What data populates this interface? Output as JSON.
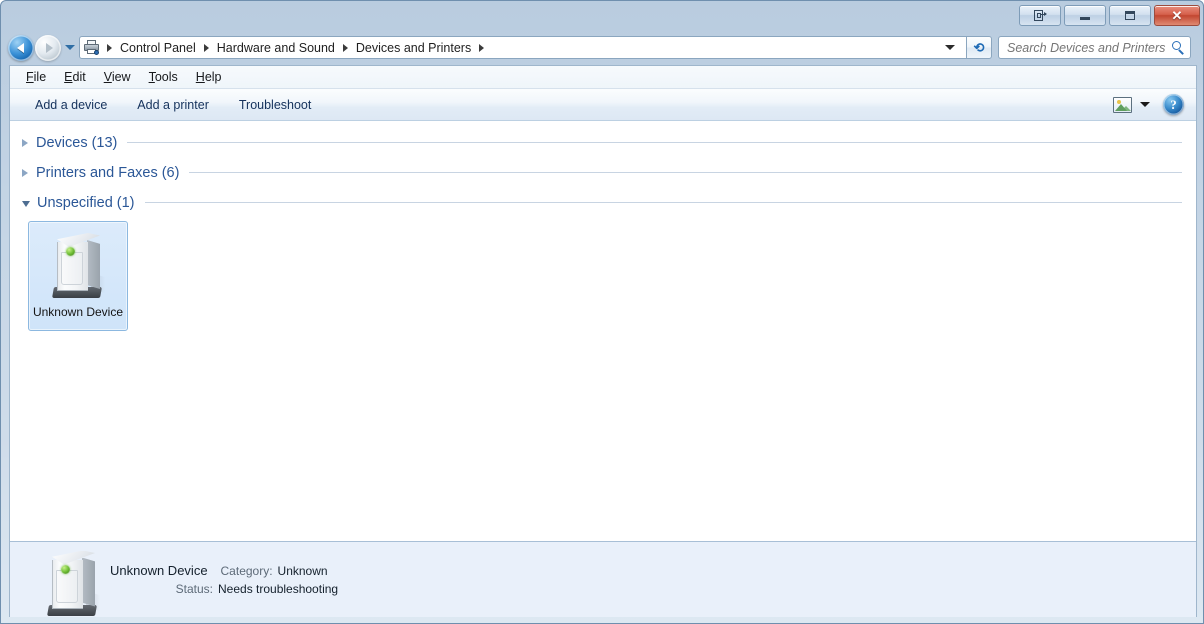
{
  "window": {
    "buttons": {
      "restore_monitor": "restore-to-monitor",
      "minimize": "minimize",
      "maximize": "maximize",
      "close": "close"
    }
  },
  "nav": {
    "back_label": "Back",
    "forward_label": "Forward",
    "recent_label": "Recent pages",
    "refresh_label": "Refresh",
    "breadcrumb_icon": "devices-and-printers-icon",
    "breadcrumbs": [
      "Control Panel",
      "Hardware and Sound",
      "Devices and Printers"
    ]
  },
  "search": {
    "placeholder": "Search Devices and Printers",
    "value": ""
  },
  "menubar": {
    "items": [
      {
        "accel": "F",
        "rest": "ile"
      },
      {
        "accel": "E",
        "rest": "dit"
      },
      {
        "accel": "V",
        "rest": "iew"
      },
      {
        "accel": "T",
        "rest": "ools"
      },
      {
        "accel": "H",
        "rest": "elp"
      }
    ]
  },
  "toolbar": {
    "add_device_label": "Add a device",
    "add_printer_label": "Add a printer",
    "troubleshoot_label": "Troubleshoot",
    "change_view_label": "Change your view",
    "help_label": "?"
  },
  "groups": [
    {
      "label": "Devices (13)",
      "expanded": false,
      "count": 13
    },
    {
      "label": "Printers and Faxes (6)",
      "expanded": false,
      "count": 6
    },
    {
      "label": "Unspecified (1)",
      "expanded": true,
      "count": 1
    }
  ],
  "items": [
    {
      "label": "Unknown Device",
      "icon": "computer-tower-icon",
      "selected": true
    }
  ],
  "details": {
    "icon": "computer-tower-icon",
    "name": "Unknown Device",
    "category_label": "Category:",
    "category_value": "Unknown",
    "status_label": "Status:",
    "status_value": "Needs troubleshooting"
  },
  "colors": {
    "group_header": "#2b5797",
    "toolbar_text": "#15325c",
    "selection_fill": "#cfe4f9",
    "selection_border": "#8cb8e0",
    "details_bg": "#e9f0fa",
    "close_button": "#c24630",
    "led_green": "#77c43c"
  }
}
